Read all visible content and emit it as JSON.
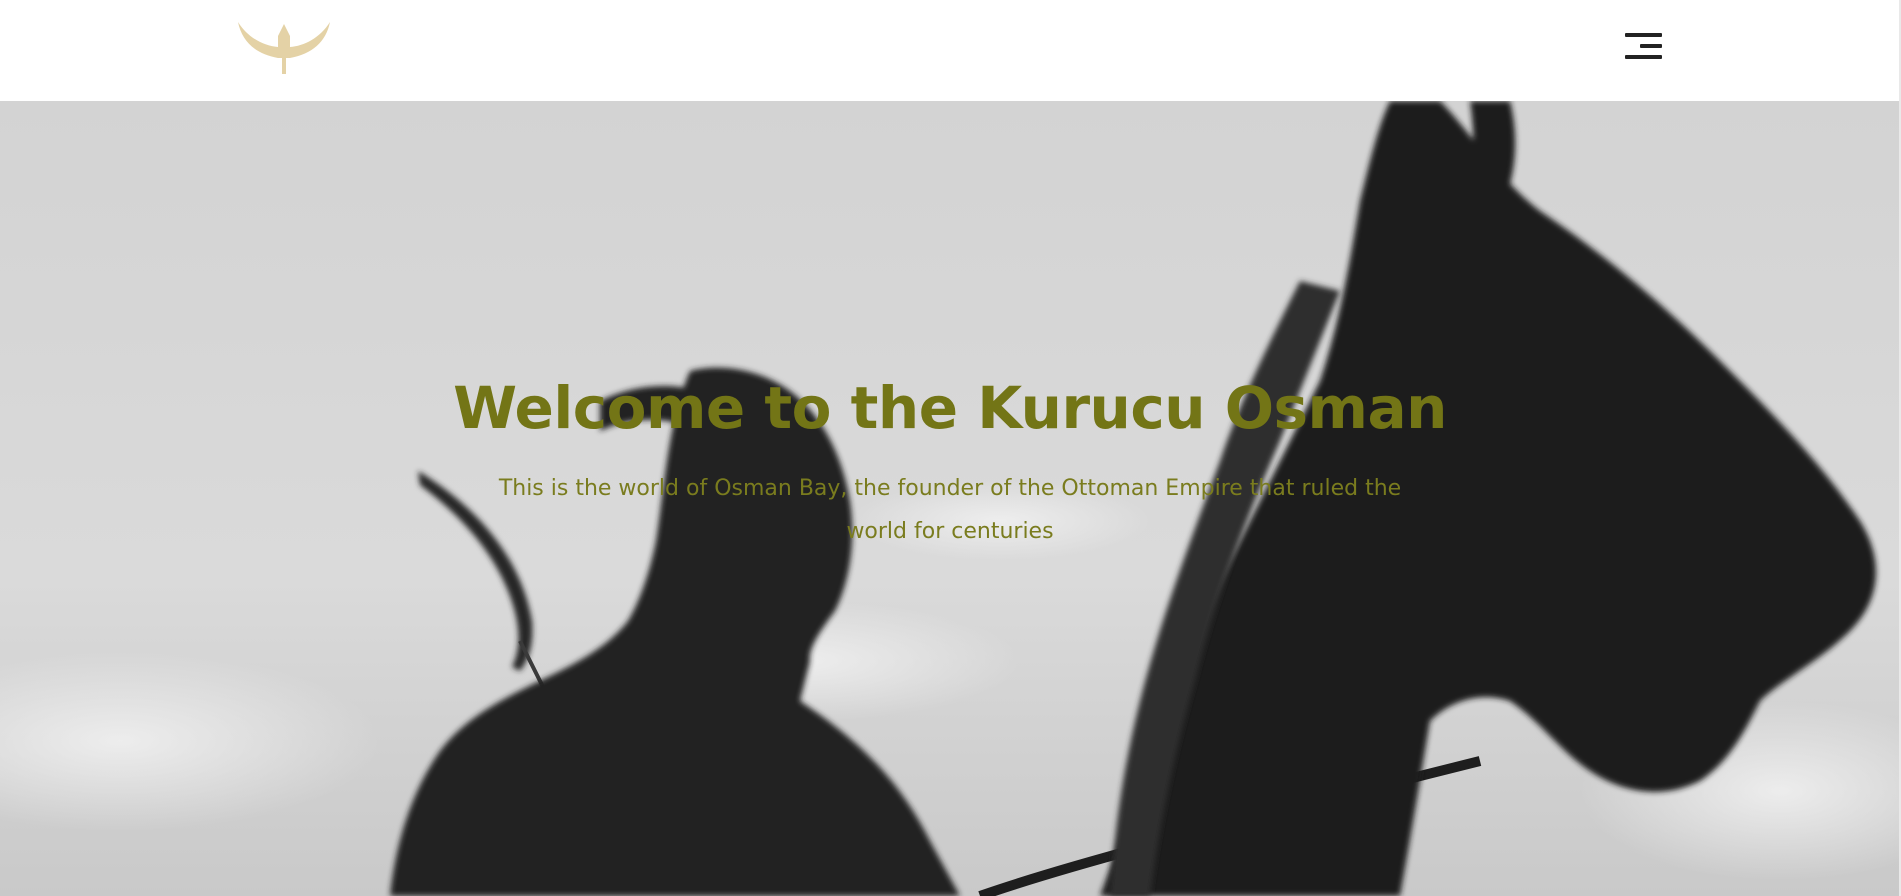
{
  "header": {
    "logo_icon": "eagle-emblem-icon",
    "menu_icon": "hamburger-menu-icon",
    "logo_color": "#e4d2a6"
  },
  "hero": {
    "title": "Welcome to the Kurucu Osman",
    "subtitle": "This is the world of Osman Bay, the founder of the Ottoman Empire that ruled the world for centuries",
    "background_image": "grayscale-rider-with-bow-and-horse-silhouette",
    "accent_color": "#737516"
  }
}
